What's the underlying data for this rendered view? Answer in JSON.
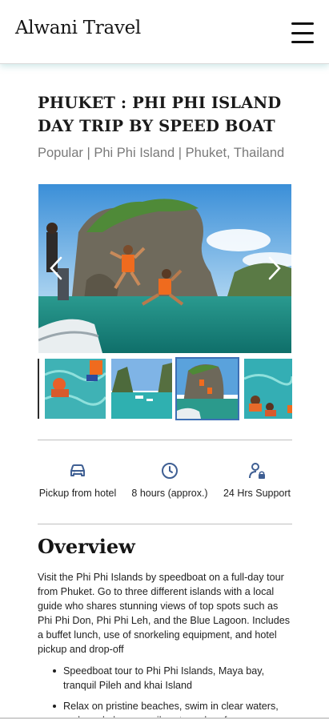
{
  "header": {
    "brand": "Alwani Travel",
    "menu_icon": "hamburger-menu-icon"
  },
  "tour": {
    "title": "PHUKET : PHI PHI ISLAND DAY TRIP BY SPEED BOAT",
    "subtitle": "Popular | Phi Phi Island | Phuket, Thailand"
  },
  "gallery": {
    "prev_icon": "chevron-left-icon",
    "next_icon": "chevron-right-icon",
    "thumbnails": [
      "snorkeling",
      "bay-boats",
      "cliff-jump",
      "swimmers"
    ],
    "active_thumbnail": 3
  },
  "features": [
    {
      "icon": "car-icon",
      "label": "Pickup from hotel"
    },
    {
      "icon": "clock-icon",
      "label": "8 hours (approx.)"
    },
    {
      "icon": "support-agent-icon",
      "label": "24 Hrs Support"
    }
  ],
  "overview": {
    "heading": "Overview",
    "paragraph": "Visit the Phi Phi Islands by speedboat on a full-day tour from Phuket. Go to three different islands with a local guide who shares stunning views of top spots such as Phi Phi Don, Phi Phi Leh, and the Blue Lagoon. Includes a buffet lunch, use of snorkeling equipment, and hotel pickup and drop-off",
    "bullets": [
      "Speedboat tour to Phi Phi Islands, Maya bay, tranquil Pileh and khai Island",
      "Relax on pristine beaches, swim in clear waters, and snorkel among vibrant coral reefs"
    ]
  },
  "colors": {
    "accent_active": "#3d6fb5",
    "icon_blue": "#3f5f93",
    "subtitle_gray": "#7a7a7a"
  }
}
